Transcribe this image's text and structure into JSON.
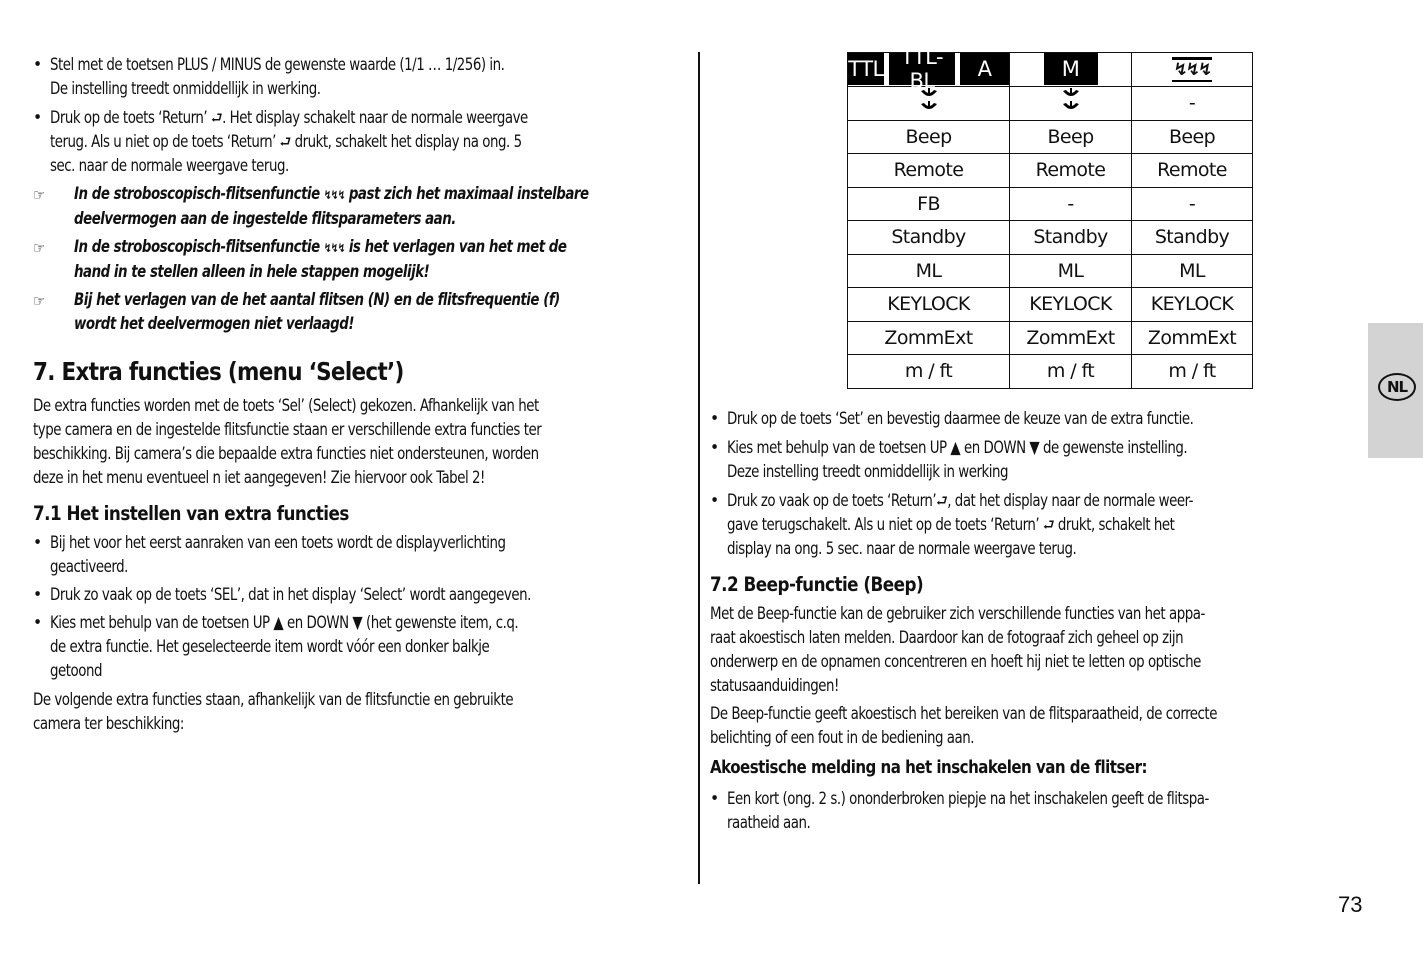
{
  "page_number": "73",
  "language_tab": "NL",
  "left_column": {
    "bullets_top": [
      {
        "lines": [
          "Stel met de toetsen  PLUS / MINUS de gewenste waarde (1/1 … 1/256) in.",
          "De instelling treedt onmiddellijk in werking."
        ]
      },
      {
        "lines": [
          "Druk op de toets ‘Return’ ",
          ". Het display schakelt naar de normale weergave",
          "terug. Als u niet op de toets ‘Return’ ",
          " drukt, schakelt het display na ong. 5",
          "sec. naar de normale weergave terug."
        ]
      }
    ],
    "notes": [
      {
        "lines": [
          "In de stroboscopisch-flitsenfunctie ",
          " past zich het maximaal instelbare",
          "deelvermogen aan de ingestelde flitsparameters aan."
        ]
      },
      {
        "lines": [
          "In de stroboscopisch-flitsenfunctie ",
          " is het verlagen van het met de",
          "hand in te stellen alleen in hele stappen mogelijk!"
        ]
      },
      {
        "lines": [
          "Bij het verlagen van de het aantal flitsen (N) en de flitsfrequentie (f)",
          "wordt het deelvermogen niet verlaagd!"
        ]
      }
    ],
    "section_title": "7. Extra functies (menu ‘Select’)",
    "intro": [
      "De extra functies worden met de toets ‘Sel’ (Select) gekozen. Afhankelijk van het",
      "type camera en de ingestelde flitsfunctie staan er verschillende extra functies ter",
      "beschikking. Bij camera’s die bepaalde extra functies niet ondersteunen, worden",
      "deze in het menu eventueel n iet aangegeven! Zie hiervoor ook Tabel 2!"
    ],
    "subsection_title": "7.1 Het instellen van extra functies",
    "steps": [
      {
        "lines": [
          "Bij het voor het eerst aanraken van een toets wordt de displayverlichting",
          "geactiveerd."
        ]
      },
      {
        "lines": [
          "Druk zo vaak op de toets ‘SEL’, dat in het display ‘Select’ wordt aangegeven."
        ]
      },
      {
        "lines": [
          "Kies met behulp van de toetsen UP ▲ en DOWN ▼ (het gewenste item, c.q.",
          "de extra functie. Het geselecteerde item wordt vóór een donker balkje",
          "getoond"
        ]
      }
    ],
    "closing": [
      "De volgende extra functies staan, afhankelijk van de flitsfunctie en gebruikte",
      "camera ter beschikking:"
    ]
  },
  "icons": {
    "return": "⮐",
    "strobe": "↯↯↯",
    "hand": "☞"
  },
  "table": {
    "header_modes": {
      "col1": [
        "TTL",
        "TTL-BL",
        "A"
      ],
      "col2": [
        "M"
      ],
      "col3_icon": "strobe-icon"
    },
    "row2": {
      "col1_icon": "zoom-reflector-icon",
      "col2_icon": "zoom-reflector-icon",
      "col3": "-"
    },
    "rows": [
      [
        "Beep",
        "Beep",
        "Beep"
      ],
      [
        "Remote",
        "Remote",
        "Remote"
      ],
      [
        "FB",
        "-",
        "-"
      ],
      [
        "Standby",
        "Standby",
        "Standby"
      ],
      [
        "ML",
        "ML",
        "ML"
      ],
      [
        "KEYLOCK",
        "KEYLOCK",
        "KEYLOCK"
      ],
      [
        "ZommExt",
        "ZommExt",
        "ZommExt"
      ],
      [
        "m / ft",
        "m / ft",
        "m / ft"
      ]
    ]
  },
  "right_column": {
    "steps": [
      {
        "lines": [
          "Druk op de toets ‘Set’  en bevestig daarmee de keuze van de extra functie."
        ]
      },
      {
        "lines": [
          "Kies met behulp van de toetsen UP ▲ en DOWN ▼ de gewenste instelling.",
          "Deze instelling treedt onmiddellijk in werking"
        ]
      },
      {
        "lines": [
          "Druk zo vaak op de toets ‘Return’",
          ", dat het display naar de normale weer-",
          "gave terugschakelt. Als u niet op de toets ‘Return’ ",
          " drukt, schakelt het",
          "display na ong. 5 sec. naar de normale weergave terug."
        ]
      }
    ],
    "subsection_title": "7.2 Beep-functie (Beep)",
    "para1": [
      "Met de Beep-functie kan de gebruiker zich verschillende functies van het appa-",
      "raat akoestisch laten melden. Daardoor kan de fotograaf zich geheel op zijn",
      "onderwerp en de opnamen concentreren en hoeft hij niet te letten op optische",
      "statusaanduidingen!"
    ],
    "para2": [
      "De Beep-functie geeft akoestisch het bereiken van de flitsparaatheid, de correcte",
      "belichting of een fout in de bediening aan."
    ],
    "bold_heading": "Akoestische melding na het inschakelen van de flitser:",
    "final_bullet": [
      "Een kort (ong. 2 s.) ononderbroken piepje na het inschakelen geeft de flitspa-",
      "raatheid aan."
    ]
  }
}
